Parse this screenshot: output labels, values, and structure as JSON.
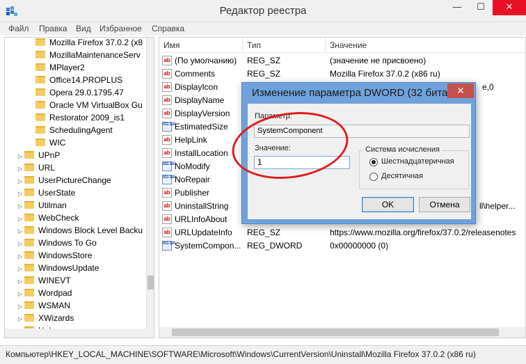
{
  "window": {
    "title": "Редактор реестра",
    "min_glyph": "—",
    "max_glyph": "☐",
    "close_glyph": "✕"
  },
  "menu": [
    "Файл",
    "Правка",
    "Вид",
    "Избранное",
    "Справка"
  ],
  "tree": {
    "items": [
      {
        "label": "Mozilla Firefox 37.0.2 (x8"
      },
      {
        "label": "MozillaMaintenanceServ"
      },
      {
        "label": "MPlayer2"
      },
      {
        "label": "Office14.PROPLUS"
      },
      {
        "label": "Opera 29.0.1795.47"
      },
      {
        "label": "Oracle VM VirtualBox Gu"
      },
      {
        "label": "Restorator 2009_is1"
      },
      {
        "label": "SchedulingAgent"
      },
      {
        "label": "WIC"
      },
      {
        "label": "UPnP"
      },
      {
        "label": "URL"
      },
      {
        "label": "UserPictureChange"
      },
      {
        "label": "UserState"
      },
      {
        "label": "Utilman"
      },
      {
        "label": "WebCheck"
      },
      {
        "label": "Windows Block Level Backu"
      },
      {
        "label": "Windows To Go"
      },
      {
        "label": "WindowsStore"
      },
      {
        "label": "WindowsUpdate"
      },
      {
        "label": "WINEVT"
      },
      {
        "label": "Wordpad"
      },
      {
        "label": "WSMAN"
      },
      {
        "label": "XWizards"
      },
      {
        "label": "Help"
      }
    ]
  },
  "list": {
    "columns": [
      "Имя",
      "Тип",
      "Значение"
    ],
    "rows": [
      {
        "name": "(По умолчанию)",
        "type": "REG_SZ",
        "value": "(значение не присвоено)",
        "icon": "string-value-icon"
      },
      {
        "name": "Comments",
        "type": "REG_SZ",
        "value": "Mozilla Firefox 37.0.2 (x86 ru)",
        "icon": "string-value-icon"
      },
      {
        "name": "DisplayIcon",
        "type": "",
        "value": "e,0",
        "icon": "string-value-icon"
      },
      {
        "name": "DisplayName",
        "type": "",
        "value": "",
        "icon": "string-value-icon"
      },
      {
        "name": "DisplayVersion",
        "type": "",
        "value": "",
        "icon": "string-value-icon"
      },
      {
        "name": "EstimatedSize",
        "type": "",
        "value": "",
        "icon": "binary-value-icon"
      },
      {
        "name": "HelpLink",
        "type": "",
        "value": "",
        "icon": "string-value-icon"
      },
      {
        "name": "InstallLocation",
        "type": "",
        "value": "",
        "icon": "string-value-icon"
      },
      {
        "name": "NoModify",
        "type": "",
        "value": "",
        "icon": "binary-value-icon"
      },
      {
        "name": "NoRepair",
        "type": "",
        "value": "",
        "icon": "binary-value-icon"
      },
      {
        "name": "Publisher",
        "type": "",
        "value": "",
        "icon": "string-value-icon"
      },
      {
        "name": "UninstallString",
        "type": "",
        "value": "ll\\helper...",
        "icon": "string-value-icon"
      },
      {
        "name": "URLInfoAbout",
        "type": "",
        "value": "",
        "icon": "string-value-icon"
      },
      {
        "name": "URLUpdateInfo",
        "type": "REG_SZ",
        "value": "https://www.mozilla.org/firefox/37.0.2/releasenotes",
        "icon": "string-value-icon"
      },
      {
        "name": "SystemCompon...",
        "type": "REG_DWORD",
        "value": "0x00000000 (0)",
        "icon": "binary-value-icon"
      }
    ],
    "icon_glyphs": {
      "string": "ab",
      "binary": "011 110"
    }
  },
  "statusbar": {
    "path": "Компьютер\\HKEY_LOCAL_MACHINE\\SOFTWARE\\Microsoft\\Windows\\CurrentVersion\\Uninstall\\Mozilla Firefox 37.0.2 (x86 ru)"
  },
  "dialog": {
    "title": "Изменение параметра DWORD (32 бита)",
    "close_glyph": "✕",
    "param_label": "Параметр:",
    "param_value": "SystemComponent",
    "value_label": "Значение:",
    "value_input": "1",
    "base_group_label": "Система исчисления",
    "radio_hex": "Шестнадцатеричная",
    "radio_dec": "Десятичная",
    "selected_base": "hex",
    "ok_label": "OK",
    "cancel_label": "Отмена"
  },
  "colors": {
    "annotation": "#e01e1e",
    "dialog_frame": "#6fa2dc",
    "close_button": "#e81123"
  }
}
